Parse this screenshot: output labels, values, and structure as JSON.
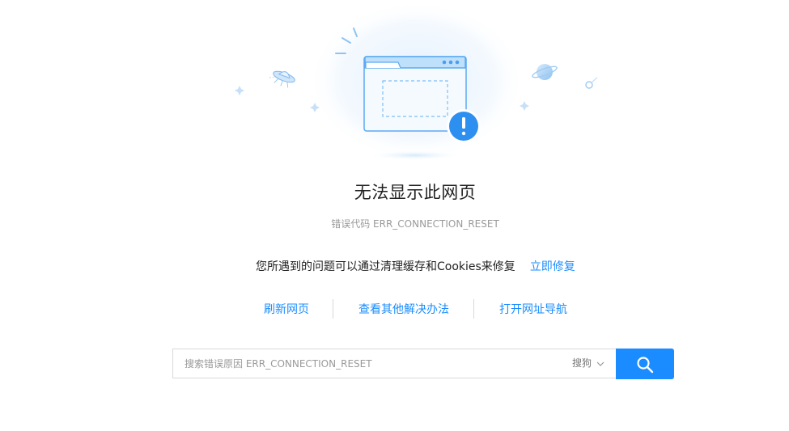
{
  "page": {
    "title": "无法显示此网页",
    "error_code": "错误代码 ERR_CONNECTION_RESET"
  },
  "fix": {
    "message": "您所遇到的问题可以通过清理缓存和Cookies来修复",
    "action_label": "立即修复"
  },
  "links": {
    "refresh": "刷新网页",
    "other_solutions": "查看其他解决办法",
    "open_nav": "打开网址导航"
  },
  "search": {
    "placeholder": "搜索错误原因 ERR_CONNECTION_RESET",
    "value": "",
    "engine": "搜狗",
    "button_icon": "search-icon"
  },
  "colors": {
    "accent": "#1a8cff",
    "illustration_blue": "#3f9df5",
    "muted_text": "#9a9a9a"
  },
  "icons": {
    "illustration": "broken-browser-window-illustration",
    "alert": "exclamation-circle-icon",
    "dropdown": "chevron-down-icon"
  }
}
